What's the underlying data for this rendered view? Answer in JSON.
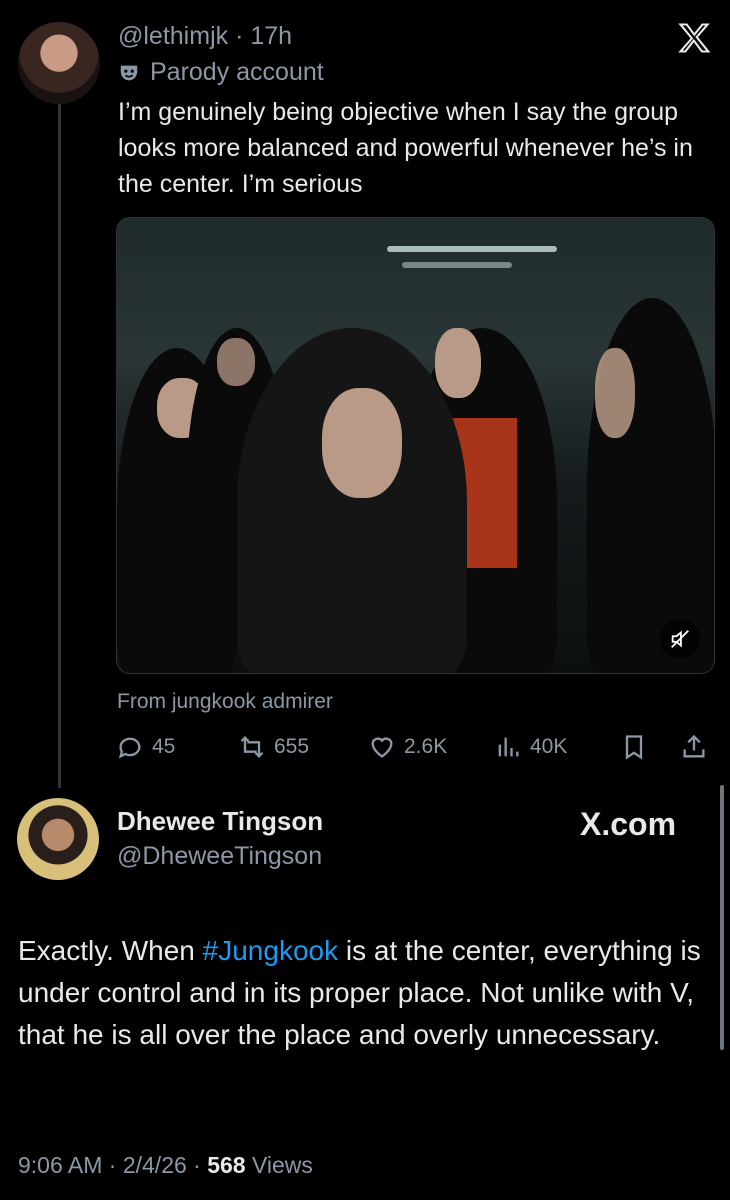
{
  "tweet": {
    "meta_line": "@lethimjk · 17h",
    "parody_label": "Parody account",
    "text": "I’m genuinely being objective when I say the group looks more balanced and powerful whenever he’s in the center. I’m serious",
    "from_line": "From jungkook admirer",
    "stats": {
      "replies": "45",
      "reposts": "655",
      "likes": "2.6K",
      "views": "40K"
    }
  },
  "reply": {
    "name": "Dhewee Tingson",
    "handle": "@DheweeTingson",
    "watermark": "X.com",
    "text_before": "Exactly. When ",
    "hashtag": "#Jungkook",
    "text_after": " is at the center, everything is under control and in its proper place. Not unlike with V, that he is all over the place and overly unnecessary.",
    "time": "9:06 AM · 2/4/26 · ",
    "views_count": "568",
    "views_label": " Views"
  },
  "colors": {
    "background": "#000000",
    "text": "#e7e9ea",
    "muted": "#8b98a5",
    "link": "#1d9bf0"
  }
}
